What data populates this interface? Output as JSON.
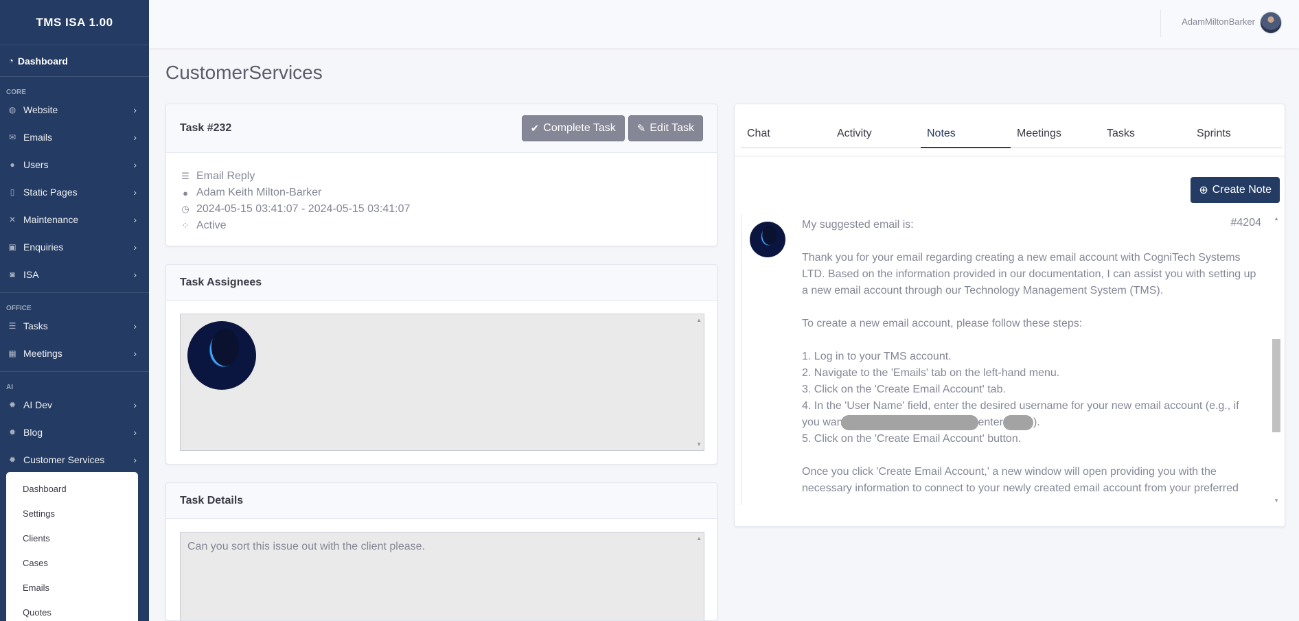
{
  "sidebar": {
    "brand": "TMS ISA 1.00",
    "dashboard": "Dashboard",
    "sections": {
      "core": "CORE",
      "office": "OFFICE",
      "ai": "AI"
    },
    "core_items": [
      {
        "label": "Website",
        "icon": "globe-icon"
      },
      {
        "label": "Emails",
        "icon": "envelope-icon"
      },
      {
        "label": "Users",
        "icon": "users-icon"
      },
      {
        "label": "Static Pages",
        "icon": "file-icon"
      },
      {
        "label": "Maintenance",
        "icon": "tools-icon"
      },
      {
        "label": "Enquiries",
        "icon": "inbox-icon"
      },
      {
        "label": "ISA",
        "icon": "robot-icon"
      }
    ],
    "office_items": [
      {
        "label": "Tasks",
        "icon": "tasks-icon"
      },
      {
        "label": "Meetings",
        "icon": "calendar-icon"
      }
    ],
    "ai_items": [
      {
        "label": "AI Dev",
        "icon": "gear-icon"
      },
      {
        "label": "Blog",
        "icon": "gear-icon"
      },
      {
        "label": "Customer Services",
        "icon": "gear-icon"
      }
    ],
    "submenu": [
      "Dashboard",
      "Settings",
      "Clients",
      "Cases",
      "Emails",
      "Quotes"
    ]
  },
  "topbar": {
    "username": "AdamMiltonBarker"
  },
  "page_title": "CustomerServices",
  "task": {
    "title": "Task #232",
    "complete_label": "Complete Task",
    "edit_label": "Edit Task",
    "type": "Email Reply",
    "person": "Adam Keith Milton-Barker",
    "dates": "2024-05-15 03:41:07 - 2024-05-15 03:41:07",
    "status": "Active"
  },
  "assignees": {
    "title": "Task Assignees"
  },
  "details": {
    "title": "Task Details",
    "text": "Can you sort this issue out with the client please."
  },
  "tabs": [
    "Chat",
    "Activity",
    "Notes",
    "Meetings",
    "Tasks",
    "Sprints"
  ],
  "create_note": "Create Note",
  "note": {
    "id": "#4204",
    "intro": "My suggested email is:",
    "p1": "Thank you for your email regarding creating a new email account with CogniTech Systems LTD. Based on the information provided in our documentation, I can assist you with setting up a new email account through our Technology Management System (TMS).",
    "p2": "To create a new email account, please follow these steps:",
    "step1": "1. Log in to your TMS account.",
    "step2": "2. Navigate to the 'Emails' tab on the left-hand menu.",
    "step3": "3. Click on the 'Create Email Account' tab.",
    "step4a": "4. In the 'User Name' field, enter the desired username for your new email account (e.g., if",
    "step4b": "you want",
    "step4c": "enter",
    "step4d": ").",
    "step5": "5. Click on the 'Create Email Account' button.",
    "p3": "Once you click 'Create Email Account,' a new window will open providing you with the necessary information to connect to your newly created email account from your preferred"
  }
}
